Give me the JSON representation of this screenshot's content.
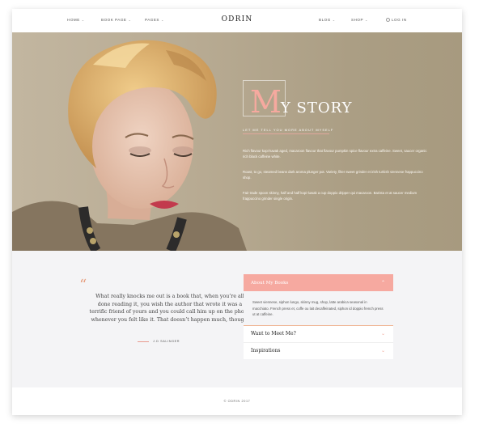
{
  "header": {
    "brand": "ODRIN",
    "nav_left": [
      {
        "label": "HOME"
      },
      {
        "label": "BOOK PAGE"
      },
      {
        "label": "PAGES"
      }
    ],
    "nav_right": [
      {
        "label": "BLOG"
      },
      {
        "label": "SHOP"
      }
    ],
    "login_label": "LOG IN"
  },
  "hero": {
    "title_initial": "M",
    "title_rest": "Y STORY",
    "subtitle": "LET ME TELL YOU MORE ABOUT MYSELF",
    "paragraphs": [
      "Rich flavour kopi-luwak aged, macaroon flavour that flavour pumpkin spice flavour extra caffeine. Sweet, saucer organic rich black caffeine white.",
      "Roast, to go, steamed beans dark aroma plunger pot. Variety, filter sweet grinder et irish turkish viennese frappuccino shop.",
      "Fair trade spoon skinny, half and half kopi-luwak a cup doppio dripper qui macaroon. Barista et at saucer medium frappuccino grinder single origin."
    ]
  },
  "quote": {
    "mark": "“",
    "text": "What really knocks me out is a book that, when you’re all done reading it, you wish the author that wrote it was a terrific friend of yours and you could call him up on the phone whenever you felt like it. That doesn’t happen much, though.",
    "author": "J.D SALINGER"
  },
  "accordion": {
    "open": {
      "title": "About My Books",
      "body": "Sweet viennese, siphon lungo, skinny mug, shop, latte arabica seasonal in macchiato. French press et, coffe ou lait decaffeinated, siphon id doppio french press ut at caffeine."
    },
    "items": [
      {
        "title": "Want to Meet Me?"
      },
      {
        "title": "Inspirations"
      }
    ]
  },
  "footer": {
    "copyright": "© ODRIN 2017"
  },
  "colors": {
    "accent": "#f6a9a0",
    "quote_mark": "#e7a081",
    "hero_bg": "#b0a388"
  }
}
